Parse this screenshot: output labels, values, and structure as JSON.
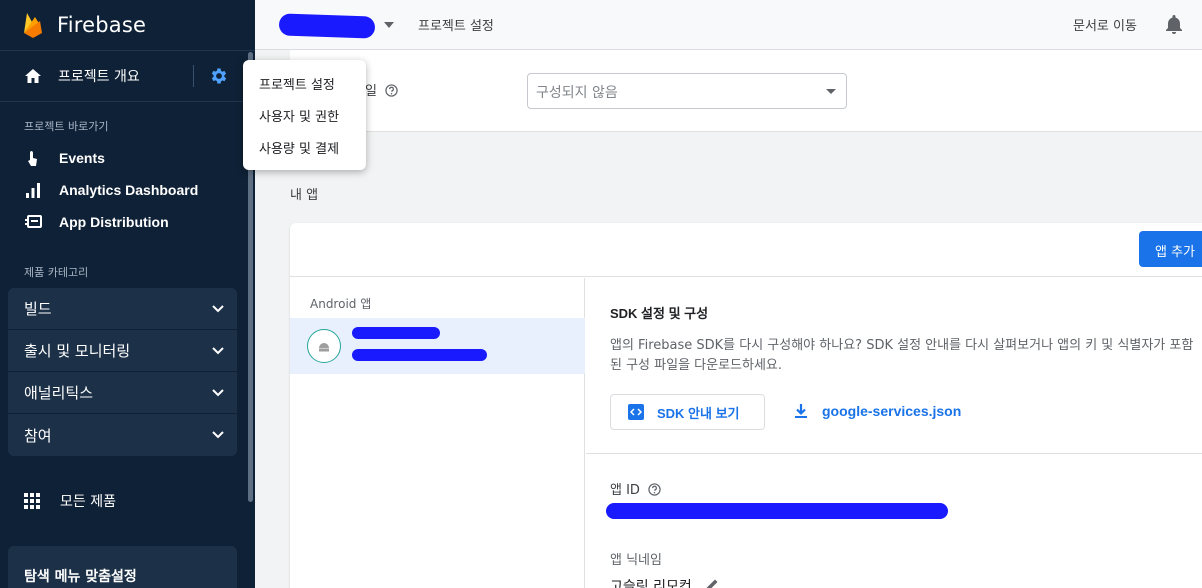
{
  "sidebar": {
    "brand": "Firebase",
    "overview_label": "프로젝트 개요",
    "shortcuts_label": "프로젝트 바로가기",
    "shortcuts": [
      {
        "label": "Events",
        "icon": "touch-icon"
      },
      {
        "label": "Analytics Dashboard",
        "icon": "bar-chart-icon"
      },
      {
        "label": "App Distribution",
        "icon": "app-distribution-icon"
      }
    ],
    "categories_label": "제품 카테고리",
    "categories": [
      "빌드",
      "출시 및 모니터링",
      "애널리틱스",
      "참여"
    ],
    "all_products": "모든 제품",
    "customize": "탐색 메뉴 맞춤설정"
  },
  "topbar": {
    "breadcrumb": "프로젝트 설정",
    "docs": "문서로 이동"
  },
  "settings_menu": {
    "items": [
      "프로젝트 설정",
      "사용자 및 권한",
      "사용량 및 결제"
    ]
  },
  "config": {
    "label": "일",
    "select_value": "구성되지 않음"
  },
  "apps": {
    "section_title": "내 앱",
    "add_button": "앱 추가",
    "android_label": "Android 앱",
    "sdk_title": "SDK 설정 및 구성",
    "sdk_desc": "앱의 Firebase SDK를 다시 구성해야 하나요? SDK 설정 안내를 다시 살펴보거나 앱의 키 및 식별자가 포함된 구성 파일을 다운로드하세요.",
    "sdk_button": "SDK 안내 보기",
    "json_link": "google-services.json",
    "app_id_label": "앱 ID",
    "nickname_label": "앱 닉네임",
    "nickname_value": "고슬링 리모컨"
  },
  "colors": {
    "sidebar_bg": "#0f2136",
    "accent": "#1a73e8",
    "redaction": "#1a1aff"
  }
}
